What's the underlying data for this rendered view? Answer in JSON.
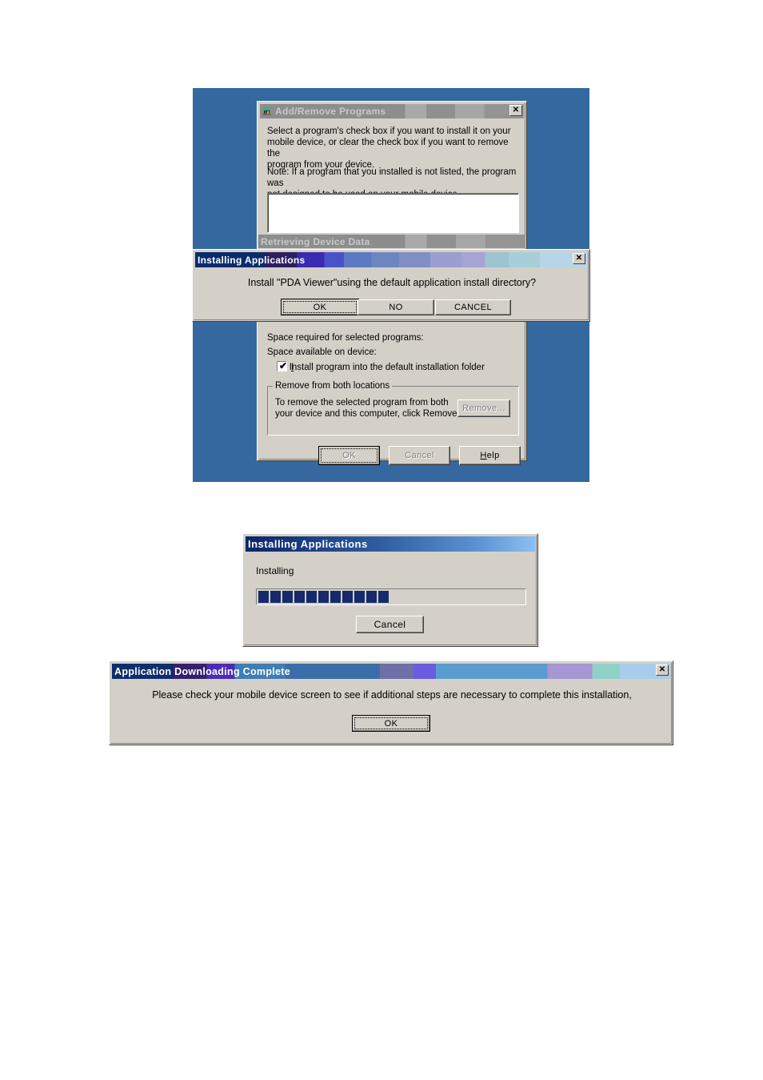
{
  "page": {
    "background_color": "#ffffff",
    "desktop_color": "#35689e"
  },
  "dialogs": {
    "add_remove": {
      "title": "Add/Remove Programs",
      "icon": "add-remove-programs-icon",
      "close_label": "✕",
      "body_text_1": "Select a program's check box if you want to install it on your\nmobile device, or clear the check box if you want to remove the\nprogram from your device.",
      "body_text_2": "Note:  If a program that you installed is not listed, the program was\nnot designed to be used on your mobile device.",
      "status_title": "Retrieving Device Data",
      "space_required_label": "Space required for selected programs:",
      "space_available_label": "Space available on device:",
      "checkbox_label_prefix": "I",
      "checkbox_label": "Install program into the default installation folder",
      "checkbox_checked": "✔",
      "group_title": "Remove from both locations",
      "group_text": "To remove the selected program from both\nyour device and this computer, click Remove.",
      "remove_button": "Remove...",
      "ok_button": "OK",
      "cancel_button": "Cancel",
      "help_button": "Help"
    },
    "installing_prompt": {
      "title": "Installing Applications",
      "close_label": "✕",
      "message": "Install \"PDA Viewer\"using the default application install directory?",
      "buttons": {
        "ok": "OK",
        "no": "NO",
        "cancel": "CANCEL"
      }
    },
    "installing_progress": {
      "title": "Installing Applications",
      "status_label": "Installing",
      "progress_blocks": 11,
      "progress_block_color": "#152a6b",
      "cancel_button": "Cancel"
    },
    "download_complete": {
      "title_bold": "Application Downloading",
      "title_rest": " Complete",
      "title": "Application Downloading Complete",
      "close_label": "✕",
      "message": "Please check your mobile device screen to see if additional steps are necessary to complete this installation,",
      "ok_button": "OK"
    }
  }
}
